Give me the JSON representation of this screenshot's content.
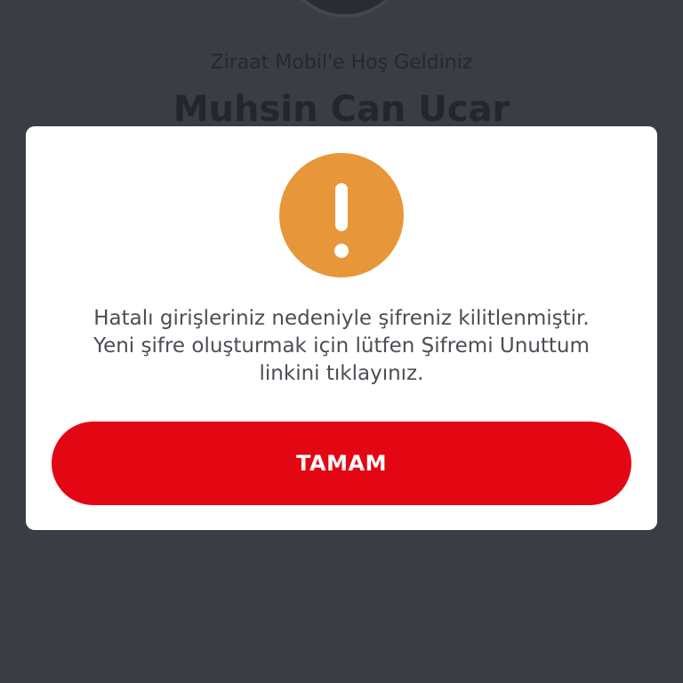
{
  "background": {
    "welcome_text": "Ziraat Mobil'e Hoş Geldiniz",
    "user_name": "Muhsin Can Ucar"
  },
  "dialog": {
    "icon": "warning-exclamation-icon",
    "icon_color": "#e8963a",
    "message_lines": [
      "Hatalı girişleriniz nedeniyle şifreniz kilitlenmiştir.",
      "Yeni şifre oluşturmak için lütfen Şifremi Unuttum",
      "linkini tıklayınız."
    ],
    "ok_label": "TAMAM",
    "button_color": "#e30613"
  }
}
